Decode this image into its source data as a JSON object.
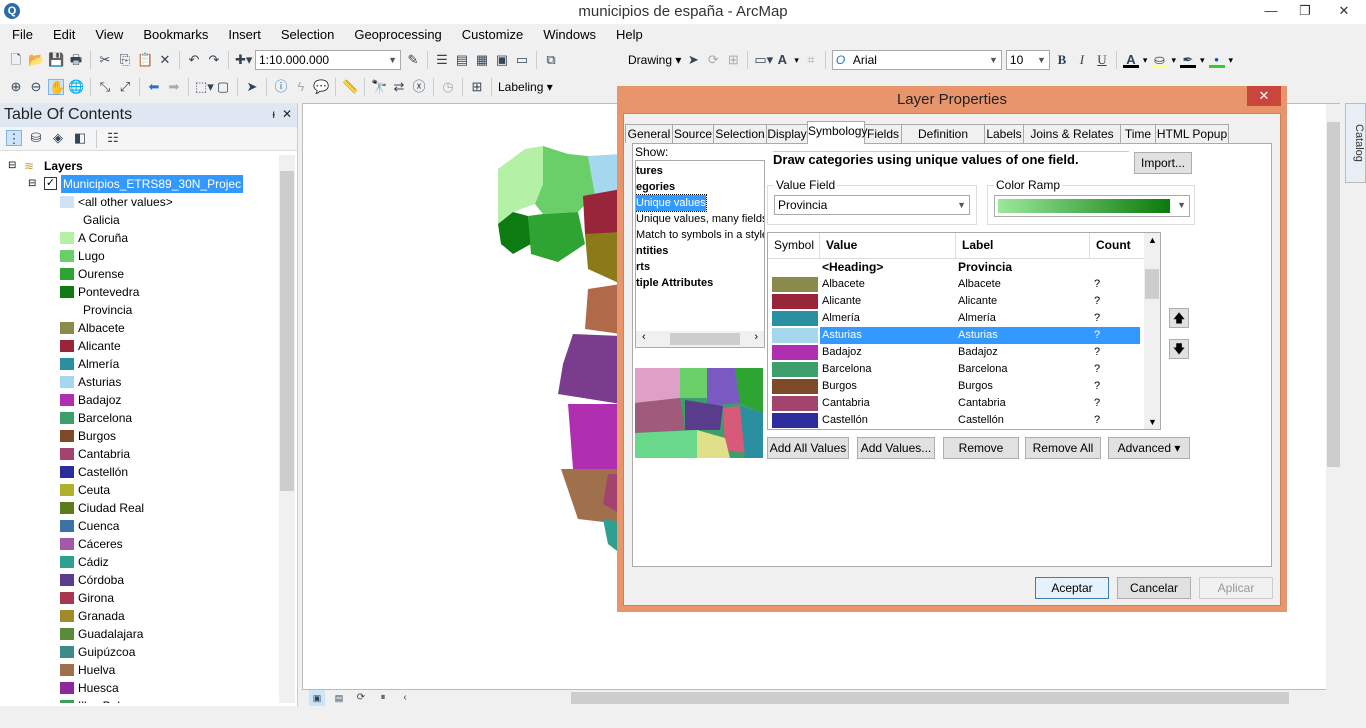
{
  "window": {
    "title": "municipios de españa - ArcMap",
    "minimize": "—",
    "maximize": "❐",
    "close": "✕"
  },
  "menu": [
    "File",
    "Edit",
    "View",
    "Bookmarks",
    "Insert",
    "Selection",
    "Geoprocessing",
    "Customize",
    "Windows",
    "Help"
  ],
  "toolbar": {
    "scale": "1:10.000.000",
    "drawing": "Drawing",
    "labeling": "Labeling",
    "font": "Arial",
    "font_size": "10",
    "bold": "B",
    "italic": "I",
    "underline": "U",
    "text_a": "A"
  },
  "toc": {
    "title": "Table Of Contents",
    "pin": "ᵻ",
    "close": "✕",
    "root": "Layers",
    "layer": "Municipios_ETRS89_30N_Projec",
    "items": [
      {
        "label": "<all other values>",
        "color": "#cfe3f3"
      },
      {
        "label": "Galicia",
        "heading": true
      },
      {
        "label": "A Coruña",
        "color": "#b4f0a6"
      },
      {
        "label": "Lugo",
        "color": "#6acf68"
      },
      {
        "label": "Ourense",
        "color": "#2ea532"
      },
      {
        "label": "Pontevedra",
        "color": "#0e7a12"
      },
      {
        "label": "Provincia",
        "heading": true
      },
      {
        "label": "Albacete",
        "color": "#8a8a4a"
      },
      {
        "label": "Alicante",
        "color": "#98253a"
      },
      {
        "label": "Almería",
        "color": "#2a8fa0"
      },
      {
        "label": "Asturias",
        "color": "#a5d8ee"
      },
      {
        "label": "Badajoz",
        "color": "#b02fb0"
      },
      {
        "label": "Barcelona",
        "color": "#3d9e6c"
      },
      {
        "label": "Burgos",
        "color": "#7d4a2a"
      },
      {
        "label": "Cantabria",
        "color": "#a3446f"
      },
      {
        "label": "Castellón",
        "color": "#2c2c9c"
      },
      {
        "label": "Ceuta",
        "color": "#b0b02c"
      },
      {
        "label": "Ciudad Real",
        "color": "#5c7a1e"
      },
      {
        "label": "Cuenca",
        "color": "#3b73a4"
      },
      {
        "label": "Cáceres",
        "color": "#a05aa8"
      },
      {
        "label": "Cádiz",
        "color": "#2da08f"
      },
      {
        "label": "Córdoba",
        "color": "#5a3c8c"
      },
      {
        "label": "Girona",
        "color": "#a5384f"
      },
      {
        "label": "Granada",
        "color": "#a08a2c"
      },
      {
        "label": "Guadalajara",
        "color": "#5a8a3c"
      },
      {
        "label": "Guipúzcoa",
        "color": "#3c8a8a"
      },
      {
        "label": "Huelva",
        "color": "#a0704c"
      },
      {
        "label": "Huesca",
        "color": "#8c2a9c"
      },
      {
        "label": "Illes Balears",
        "color": "#3ca05c"
      }
    ]
  },
  "catalog": "Catalog",
  "dialog": {
    "title": "Layer Properties",
    "close": "✕",
    "tabs": [
      "General",
      "Source",
      "Selection",
      "Display",
      "Symbology",
      "Fields",
      "Definition Query",
      "Labels",
      "Joins & Relates",
      "Time",
      "HTML Popup"
    ],
    "active_tab": "Symbology",
    "show_label": "Show:",
    "show_items": [
      {
        "label": "tures",
        "bold": true
      },
      {
        "label": "egories",
        "bold": true
      },
      {
        "label": "Unique values",
        "selected": true
      },
      {
        "label": "Unique values, many fields"
      },
      {
        "label": "Match to symbols in a style"
      },
      {
        "label": "ntities",
        "bold": true
      },
      {
        "label": "rts",
        "bold": true
      },
      {
        "label": "tiple Attributes",
        "bold": true
      }
    ],
    "description": "Draw categories using unique values of one field.",
    "import": "Import...",
    "value_field_label": "Value Field",
    "value_field": "Provincia",
    "color_ramp_label": "Color Ramp",
    "color_ramp": [
      "#9be89b",
      "#0a7a0a"
    ],
    "columns": [
      "Symbol",
      "Value",
      "Label",
      "Count"
    ],
    "heading_row": {
      "value": "<Heading>",
      "label": "Provincia"
    },
    "rows": [
      {
        "value": "Albacete",
        "label": "Albacete",
        "count": "?",
        "color": "#8a8a4a"
      },
      {
        "value": "Alicante",
        "label": "Alicante",
        "count": "?",
        "color": "#98253a"
      },
      {
        "value": "Almería",
        "label": "Almería",
        "count": "?",
        "color": "#2a8fa0"
      },
      {
        "value": "Asturias",
        "label": "Asturias",
        "count": "?",
        "color": "#a5d8ee",
        "selected": true
      },
      {
        "value": "Badajoz",
        "label": "Badajoz",
        "count": "?",
        "color": "#b02fb0"
      },
      {
        "value": "Barcelona",
        "label": "Barcelona",
        "count": "?",
        "color": "#3d9e6c"
      },
      {
        "value": "Burgos",
        "label": "Burgos",
        "count": "?",
        "color": "#7d4a2a"
      },
      {
        "value": "Cantabria",
        "label": "Cantabria",
        "count": "?",
        "color": "#a3446f"
      },
      {
        "value": "Castellón",
        "label": "Castellón",
        "count": "?",
        "color": "#2c2c9c"
      }
    ],
    "buttons": {
      "add_all": "Add All Values",
      "add": "Add Values...",
      "remove": "Remove",
      "remove_all": "Remove All",
      "advanced": "Advanced"
    },
    "ok": "Aceptar",
    "cancel": "Cancelar",
    "apply": "Aplicar"
  },
  "colors": {
    "selection": "#3399ff",
    "dialog_frame": "#e8956c"
  }
}
